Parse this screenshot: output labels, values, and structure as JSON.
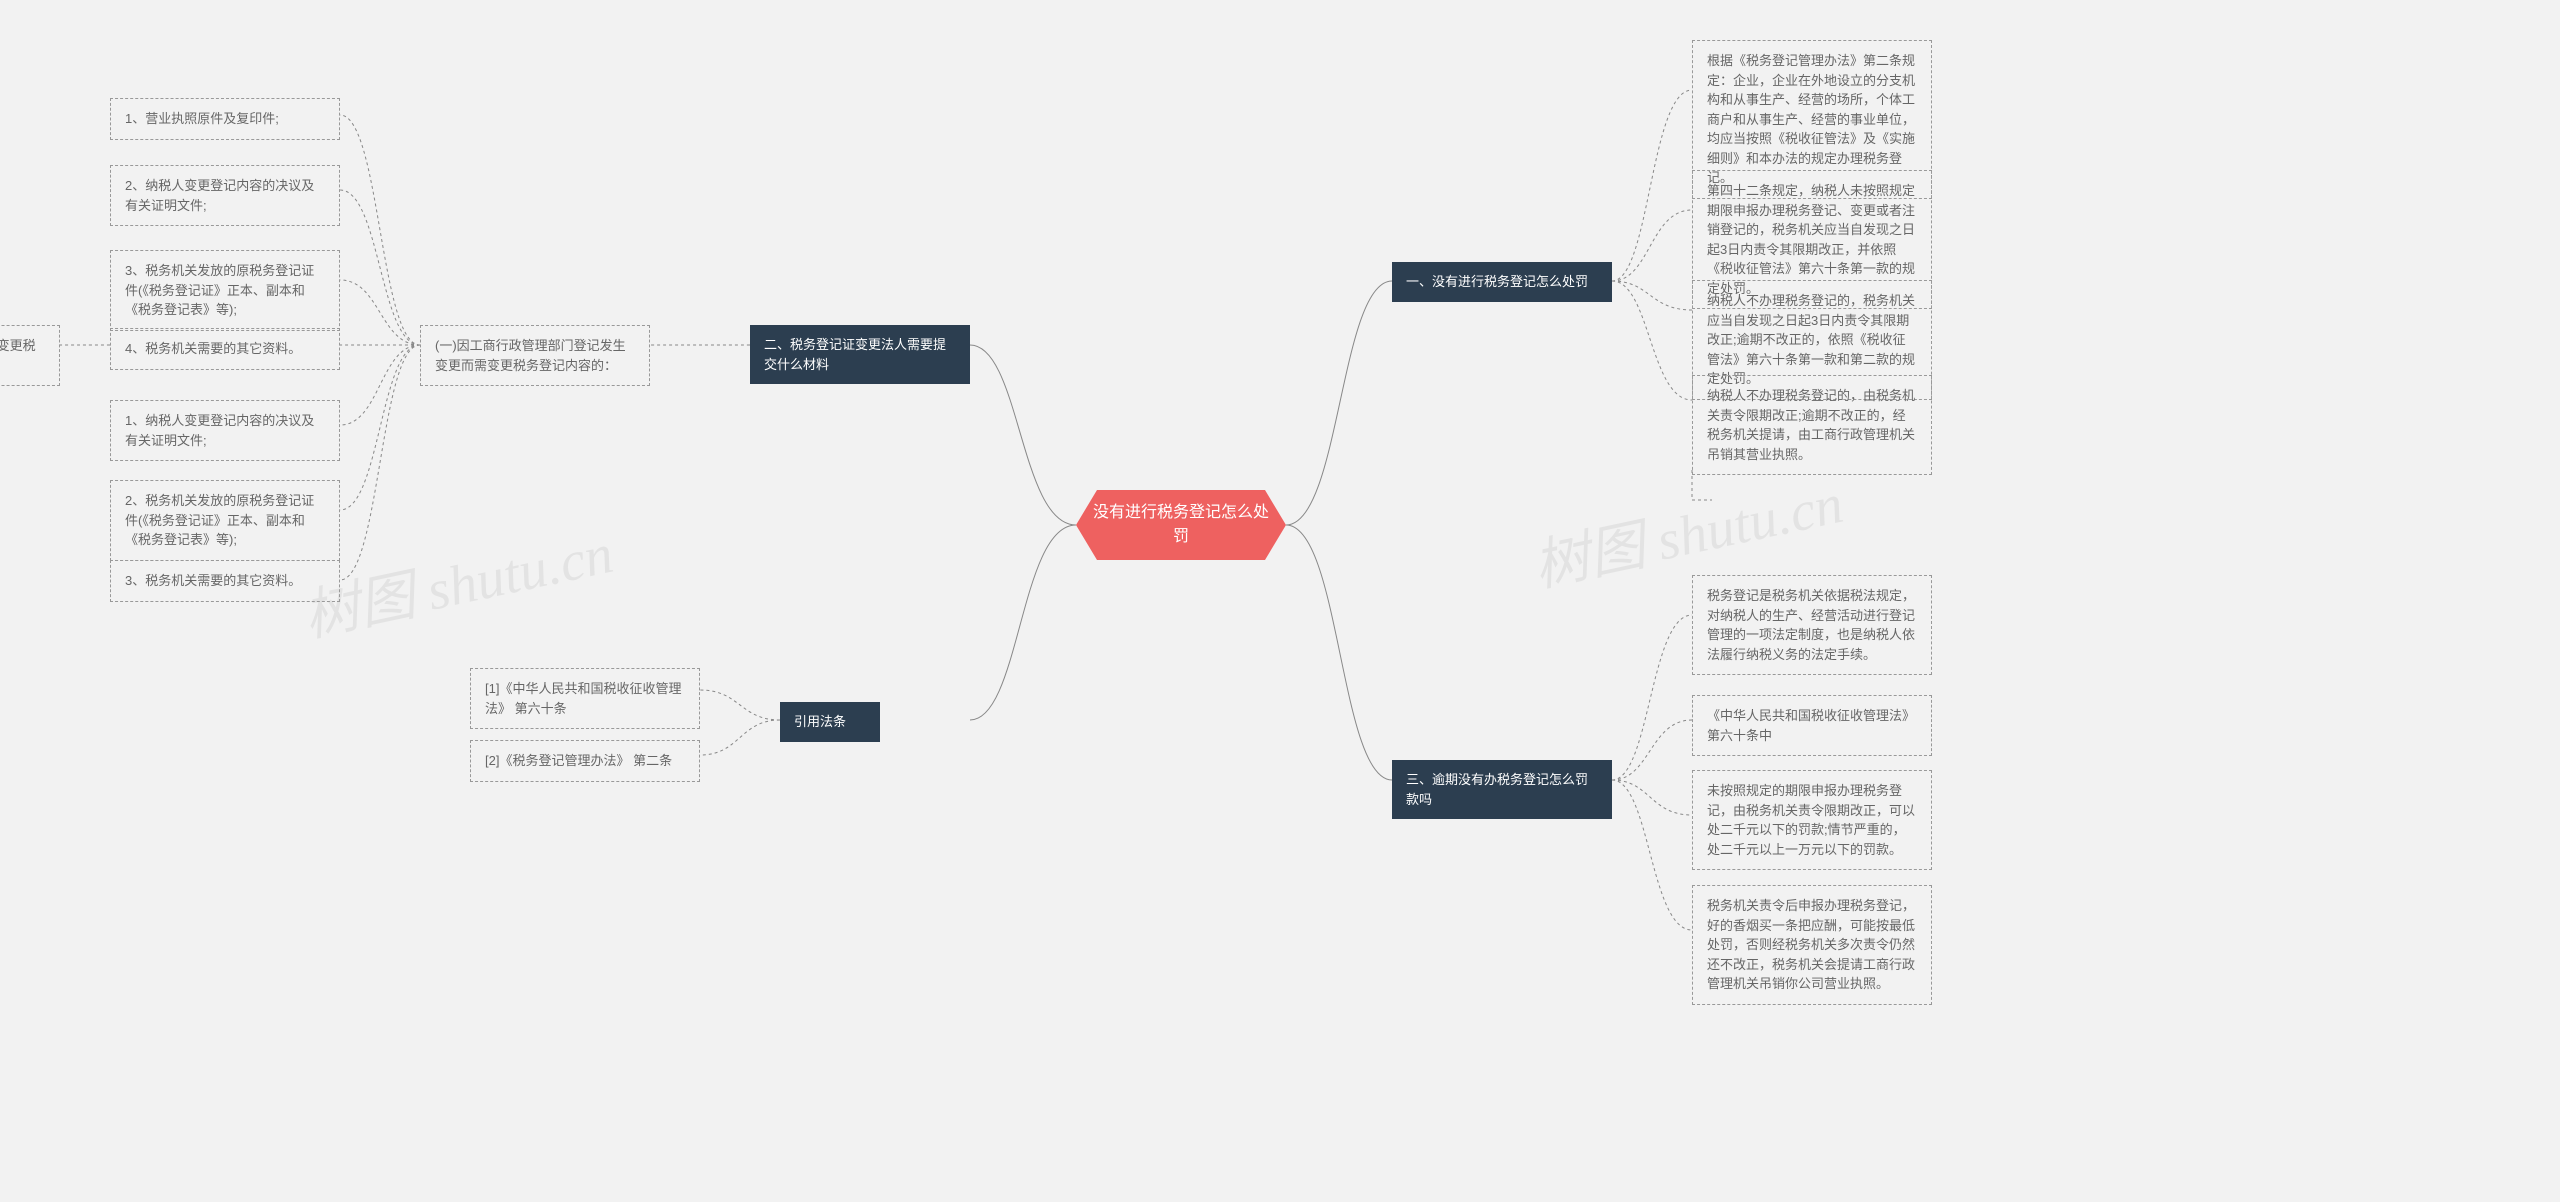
{
  "root": {
    "title": "没有进行税务登记怎么处罚"
  },
  "right": {
    "branch1": {
      "title": "一、没有进行税务登记怎么处罚",
      "leaves": [
        "根据《税务登记管理办法》第二条规定：企业，企业在外地设立的分支机构和从事生产、经营的场所，个体工商户和从事生产、经营的事业单位，均应当按照《税收征管法》及《实施细则》和本办法的规定办理税务登记。",
        "第四十二条规定，纳税人未按照规定期限申报办理税务登记、变更或者注销登记的，税务机关应当自发现之日起3日内责令其限期改正，并依照《税收征管法》第六十条第一款的规定处罚。",
        "纳税人不办理税务登记的，税务机关应当自发现之日起3日内责令其限期改正;逾期不改正的，依照《税收征管法》第六十条第一款和第二款的规定处罚。",
        "纳税人不办理税务登记的，由税务机关责令限期改正;逾期不改正的，经税务机关提请，由工商行政管理机关吊销其营业执照。"
      ]
    },
    "branch3": {
      "title": "三、逾期没有办税务登记怎么罚款吗",
      "leaves": [
        "税务登记是税务机关依据税法规定，对纳税人的生产、经营活动进行登记管理的一项法定制度，也是纳税人依法履行纳税义务的法定手续。",
        "《中华人民共和国税收征收管理法》第六十条中",
        "未按照规定的期限申报办理税务登记，由税务机关责令限期改正，可以处二千元以下的罚款;情节严重的，处二千元以上一万元以下的罚款。",
        "税务机关责令后申报办理税务登记，好的香烟买一条把应酬，可能按最低处罚，否则经税务机关多次责令仍然还不改正，税务机关会提请工商行政管理机关吊销你公司营业执照。"
      ]
    }
  },
  "left": {
    "branch2": {
      "title": "二、税务登记证变更法人需要提交什么材料",
      "subA": {
        "label": "(一)因工商行政管理部门登记发生变更而需变更税务登记内容的：",
        "leaves": [
          "1、营业执照原件及复印件;",
          "2、纳税人变更登记内容的决议及有关证明文件;",
          "3、税务机关发放的原税务登记证件(《税务登记证》正本、副本和《税务登记表》等);",
          "4、税务机关需要的其它资料。"
        ]
      },
      "subB": {
        "label": "(二)非工商登记变更因素而变更税务登记内容的;",
        "leaves": [
          "1、纳税人变更登记内容的决议及有关证明文件;",
          "2、税务机关发放的原税务登记证件(《税务登记证》正本、副本和《税务登记表》等);",
          "3、税务机关需要的其它资料。"
        ]
      }
    },
    "branchRef": {
      "title": "引用法条",
      "leaves": [
        "[1]《中华人民共和国税收征收管理法》 第六十条",
        "[2]《税务登记管理办法》 第二条"
      ]
    }
  },
  "watermarks": [
    "树图 shutu.cn",
    "树图 shutu.cn"
  ]
}
